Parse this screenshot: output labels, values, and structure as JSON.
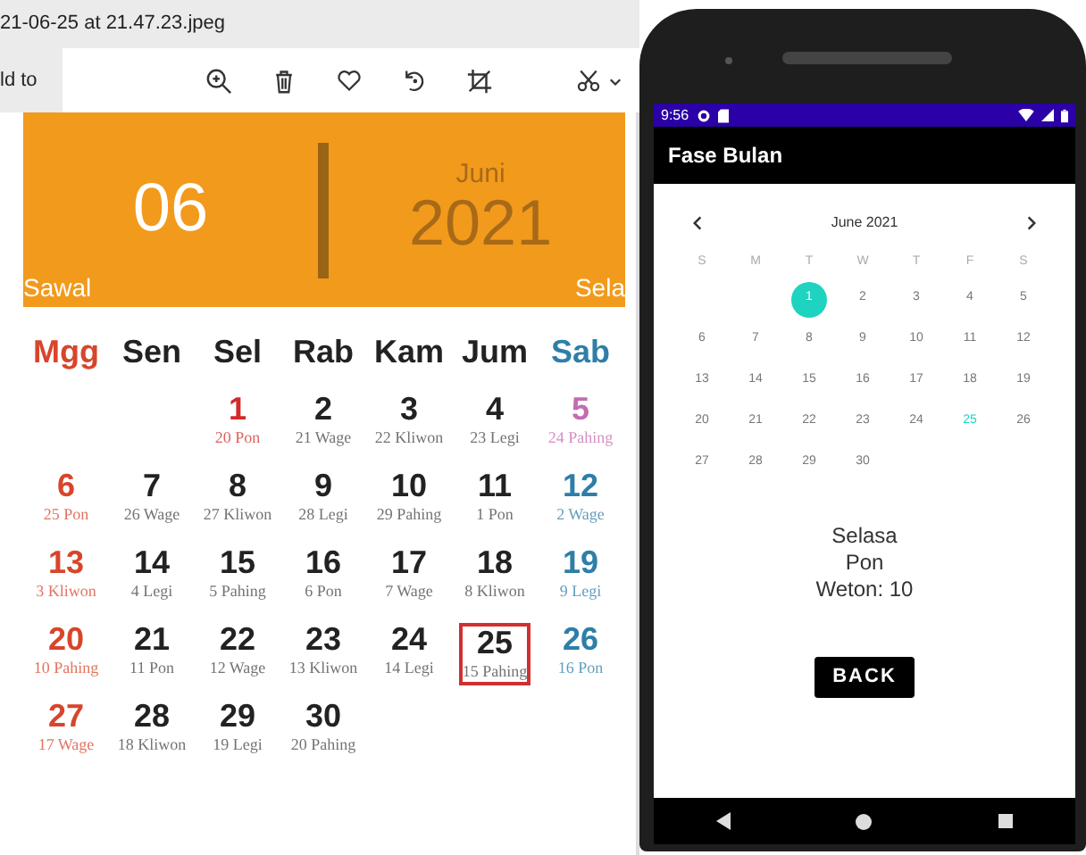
{
  "viewer": {
    "file_title": "21-06-25 at 21.47.23.jpeg",
    "add_to": "ld to"
  },
  "photo": {
    "banner": {
      "day": "06",
      "month": "Juni",
      "year": "2021",
      "hijri_left": "Sawal",
      "hijri_right": "Sela"
    },
    "weekdays": [
      {
        "label": "Mgg",
        "color": "#d8452b"
      },
      {
        "label": "Sen",
        "color": "#222222"
      },
      {
        "label": "Sel",
        "color": "#222222"
      },
      {
        "label": "Rab",
        "color": "#222222"
      },
      {
        "label": "Kam",
        "color": "#222222"
      },
      {
        "label": "Jum",
        "color": "#222222"
      },
      {
        "label": "Sab",
        "color": "#2e7ea8"
      }
    ],
    "weeks": [
      [
        {
          "kind": "blank"
        },
        {
          "kind": "blank"
        },
        {
          "kind": "day",
          "day": "1",
          "pasaran": "20 Pon",
          "color": "#d12b2b",
          "selected": false
        },
        {
          "day": "2",
          "pasaran": "21 Wage",
          "color": "#222222",
          "selected": false
        },
        {
          "day": "3",
          "pasaran": "22 Kliwon",
          "color": "#222222",
          "selected": false
        },
        {
          "day": "4",
          "pasaran": "23 Legi",
          "color": "#222222",
          "selected": false
        },
        {
          "day": "5",
          "pasaran": "24 Pahing",
          "color": "#c56bb0",
          "selected": false
        }
      ],
      [
        {
          "day": "6",
          "pasaran": "25 Pon",
          "color": "#d8452b",
          "selected": false
        },
        {
          "day": "7",
          "pasaran": "26 Wage",
          "color": "#222222",
          "selected": false
        },
        {
          "day": "8",
          "pasaran": "27 Kliwon",
          "color": "#222222",
          "selected": false
        },
        {
          "day": "9",
          "pasaran": "28 Legi",
          "color": "#222222",
          "selected": false
        },
        {
          "day": "10",
          "pasaran": "29 Pahing",
          "color": "#222222",
          "selected": false
        },
        {
          "day": "11",
          "pasaran": "1 Pon",
          "color": "#222222",
          "selected": false
        },
        {
          "day": "12",
          "pasaran": "2 Wage",
          "color": "#2e7ea8",
          "selected": false
        }
      ],
      [
        {
          "day": "13",
          "pasaran": "3 Kliwon",
          "color": "#d8452b",
          "selected": false
        },
        {
          "day": "14",
          "pasaran": "4 Legi",
          "color": "#222222",
          "selected": false
        },
        {
          "day": "15",
          "pasaran": "5 Pahing",
          "color": "#222222",
          "selected": false
        },
        {
          "day": "16",
          "pasaran": "6 Pon",
          "color": "#222222",
          "selected": false
        },
        {
          "day": "17",
          "pasaran": "7 Wage",
          "color": "#222222",
          "selected": false
        },
        {
          "day": "18",
          "pasaran": "8 Kliwon",
          "color": "#222222",
          "selected": false
        },
        {
          "day": "19",
          "pasaran": "9 Legi",
          "color": "#2e7ea8",
          "selected": false
        }
      ],
      [
        {
          "day": "20",
          "pasaran": "10 Pahing",
          "color": "#d8452b",
          "selected": false
        },
        {
          "day": "21",
          "pasaran": "11 Pon",
          "color": "#222222",
          "selected": false
        },
        {
          "day": "22",
          "pasaran": "12 Wage",
          "color": "#222222",
          "selected": false
        },
        {
          "day": "23",
          "pasaran": "13 Kliwon",
          "color": "#222222",
          "selected": false
        },
        {
          "day": "24",
          "pasaran": "14 Legi",
          "color": "#222222",
          "selected": false
        },
        {
          "day": "25",
          "pasaran": "15 Pahing",
          "color": "#222222",
          "selected": true
        },
        {
          "day": "26",
          "pasaran": "16 Pon",
          "color": "#2e7ea8",
          "selected": false
        }
      ],
      [
        {
          "day": "27",
          "pasaran": "17 Wage",
          "color": "#d8452b",
          "selected": false
        },
        {
          "day": "28",
          "pasaran": "18 Kliwon",
          "color": "#222222",
          "selected": false
        },
        {
          "day": "29",
          "pasaran": "19 Legi",
          "color": "#222222",
          "selected": false
        },
        {
          "day": "30",
          "pasaran": "20 Pahing",
          "color": "#222222",
          "selected": false
        }
      ]
    ]
  },
  "phone": {
    "status_time": "9:56",
    "app_title": "Fase Bulan",
    "picker": {
      "month": "June 2021",
      "weekdays": [
        "S",
        "M",
        "T",
        "W",
        "T",
        "F",
        "S"
      ],
      "weeks": [
        [
          {
            "kind": "blank"
          },
          {
            "kind": "blank"
          },
          {
            "kind": "day",
            "day": "1",
            "selected": true,
            "today": false
          },
          {
            "day": "2",
            "selected": false,
            "today": false
          },
          {
            "day": "3",
            "selected": false,
            "today": false
          },
          {
            "day": "4",
            "selected": false,
            "today": false
          },
          {
            "day": "5",
            "selected": false,
            "today": false
          }
        ],
        [
          {
            "day": "6",
            "selected": false,
            "today": false
          },
          {
            "day": "7",
            "selected": false,
            "today": false
          },
          {
            "day": "8",
            "selected": false,
            "today": false
          },
          {
            "day": "9",
            "selected": false,
            "today": false
          },
          {
            "day": "10",
            "selected": false,
            "today": false
          },
          {
            "day": "11",
            "selected": false,
            "today": false
          },
          {
            "day": "12",
            "selected": false,
            "today": false
          }
        ],
        [
          {
            "day": "13",
            "selected": false,
            "today": false
          },
          {
            "day": "14",
            "selected": false,
            "today": false
          },
          {
            "day": "15",
            "selected": false,
            "today": false
          },
          {
            "day": "16",
            "selected": false,
            "today": false
          },
          {
            "day": "17",
            "selected": false,
            "today": false
          },
          {
            "day": "18",
            "selected": false,
            "today": false
          },
          {
            "day": "19",
            "selected": false,
            "today": false
          }
        ],
        [
          {
            "day": "20",
            "selected": false,
            "today": false
          },
          {
            "day": "21",
            "selected": false,
            "today": false
          },
          {
            "day": "22",
            "selected": false,
            "today": false
          },
          {
            "day": "23",
            "selected": false,
            "today": false
          },
          {
            "day": "24",
            "selected": false,
            "today": false
          },
          {
            "day": "25",
            "selected": false,
            "today": true
          },
          {
            "day": "26",
            "selected": false,
            "today": false
          }
        ],
        [
          {
            "day": "27",
            "selected": false,
            "today": false
          },
          {
            "day": "28",
            "selected": false,
            "today": false
          },
          {
            "day": "29",
            "selected": false,
            "today": false
          },
          {
            "day": "30",
            "selected": false,
            "today": false
          }
        ]
      ]
    },
    "result": [
      "Selasa",
      "Pon",
      "Weton: 10"
    ],
    "back_button": "BACK"
  }
}
